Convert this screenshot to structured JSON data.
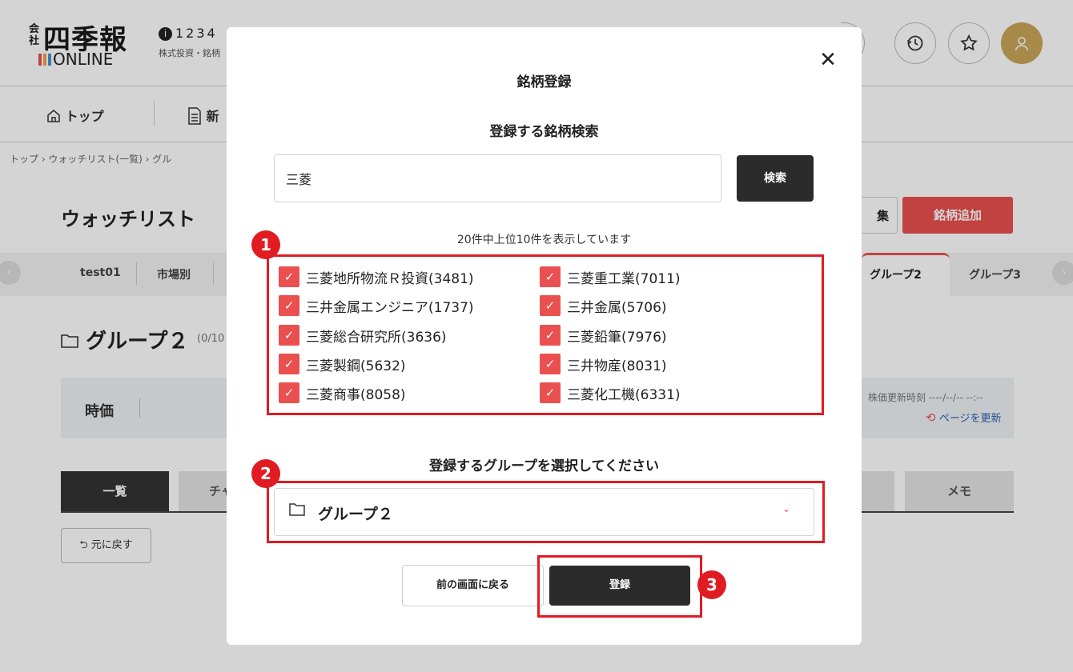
{
  "header": {
    "logo_kanji": "四季報",
    "logo_prefix": "会社",
    "logo_online": "ONLINE",
    "logo_bar_colors": [
      "#e9504f",
      "#f0a040",
      "#4a8fd0"
    ],
    "code_info_icon": "info-icon",
    "code_text": "1234",
    "code_sub": "株式投資・銘柄",
    "icons": [
      "history-icon",
      "star-icon",
      "user-icon"
    ]
  },
  "nav": {
    "top_label": "トップ",
    "second_label": "新"
  },
  "breadcrumb": "トップ › ウォッチリスト(一覧) › グル",
  "watchlist": {
    "title": "ウォッチリスト",
    "edit_label": "集",
    "add_label": "銘柄追加",
    "tabs": [
      "test01",
      "市場別"
    ],
    "right_tabs": [
      "グループ2",
      "グループ3"
    ],
    "group_title": "グループ２",
    "group_count": "(0/10",
    "price_label": "時価",
    "update_time": "株価更新時刻 ----/--/-- --:--",
    "refresh_label": "ページを更新",
    "view_tabs": [
      "一覧",
      "チャ",
      "メモ"
    ],
    "back_label": "元に戻す"
  },
  "modal": {
    "title": "銘柄登録",
    "search_heading": "登録する銘柄検索",
    "search_value": "三菱",
    "search_button": "検索",
    "result_note": "20件中上位10件を表示しています",
    "results_left": [
      {
        "label": "三菱地所物流Ｒ投資(3481)",
        "checked": true
      },
      {
        "label": "三井金属エンジニア(1737)",
        "checked": true
      },
      {
        "label": "三菱総合研究所(3636)",
        "checked": true
      },
      {
        "label": "三菱製鋼(5632)",
        "checked": true
      },
      {
        "label": "三菱商事(8058)",
        "checked": true
      }
    ],
    "results_right": [
      {
        "label": "三菱重工業(7011)",
        "checked": true
      },
      {
        "label": "三井金属(5706)",
        "checked": true
      },
      {
        "label": "三菱鉛筆(7976)",
        "checked": true
      },
      {
        "label": "三井物産(8031)",
        "checked": true
      },
      {
        "label": "三菱化工機(6331)",
        "checked": true
      }
    ],
    "group_heading": "登録するグループを選択してください",
    "group_selected": "グループ２",
    "back_button": "前の画面に戻る",
    "register_button": "登録",
    "close_icon": "close-icon"
  },
  "annotations": {
    "badge_1": "1",
    "badge_2": "2",
    "badge_3": "3",
    "highlight_color": "#e11b22"
  },
  "colors": {
    "accent": "#e9504f",
    "dark_button": "#2b2b2b"
  }
}
